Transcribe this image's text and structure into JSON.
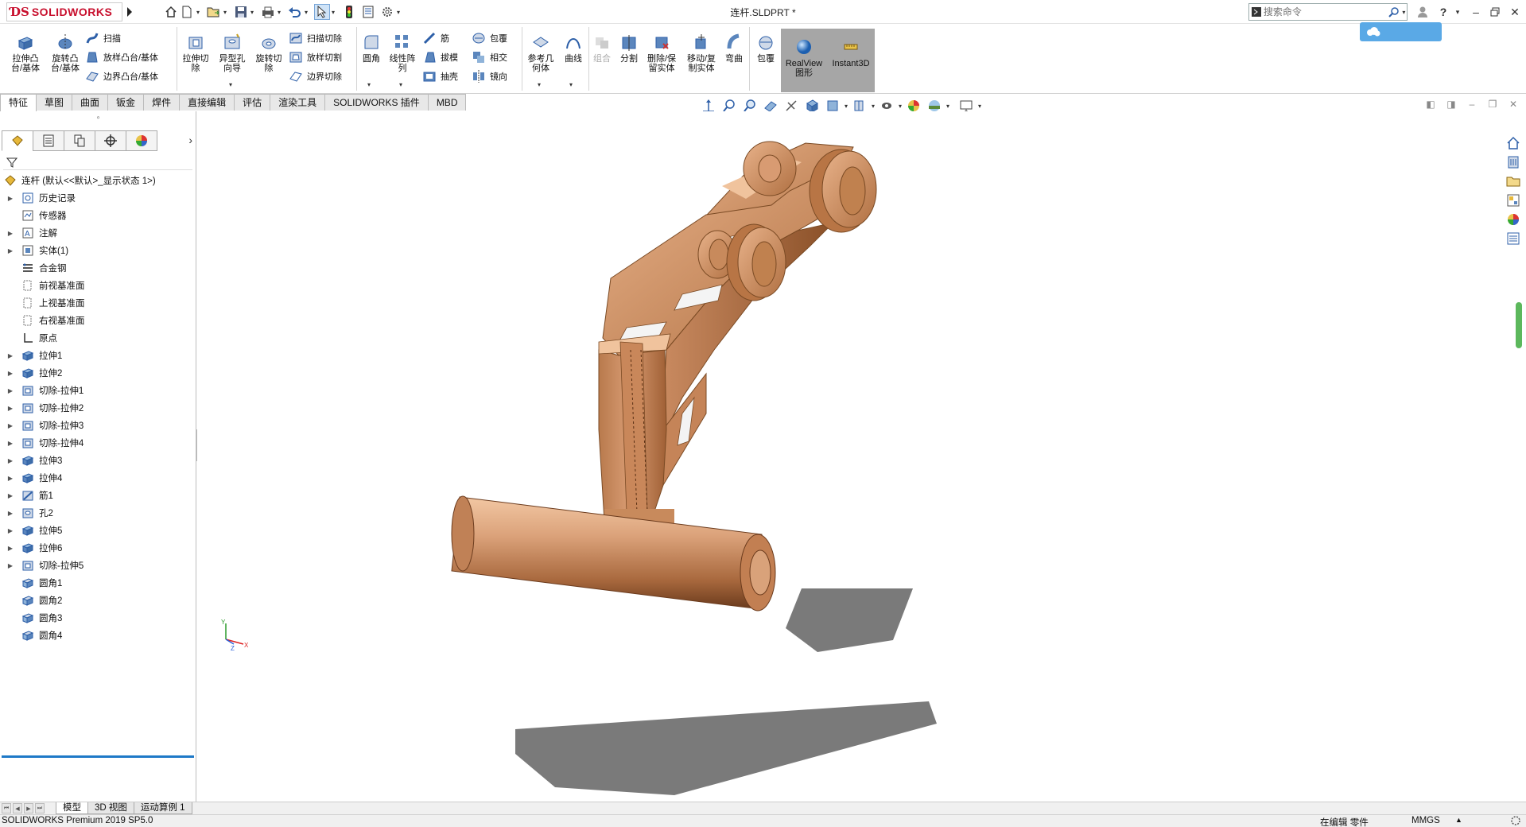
{
  "app": {
    "brand_prefix": "3S",
    "brand_name": "SOLIDWORKS",
    "document_title": "连杆.SLDPRT *"
  },
  "search": {
    "placeholder": "搜索命令"
  },
  "promo_badge": "",
  "command_manager": {
    "extrude_boss": "拉伸凸\n台/基体",
    "revolve_boss": "旋转凸\n台/基体",
    "sweep": "扫描",
    "loft_boss": "放样凸台/基体",
    "boundary_boss": "边界凸台/基体",
    "extrude_cut": "拉伸切\n除",
    "hole_wizard": "异型孔\n向导",
    "revolve_cut": "旋转切\n除",
    "swept_cut": "扫描切除",
    "lofted_cut": "放样切割",
    "boundary_cut": "边界切除",
    "fillet": "圆角",
    "linear_pattern": "线性阵\n列",
    "rib": "筋",
    "draft": "拔模",
    "shell": "抽壳",
    "wrap": "包覆",
    "intersect": "相交",
    "mirror": "镜向",
    "ref_geometry": "参考几\n何体",
    "curves": "曲线",
    "combine": "组合",
    "split": "分割",
    "delete_keep_body": "删除/保\n留实体",
    "move_copy_body": "移动/复\n制实体",
    "flex": "弯曲",
    "wrap2": "包覆",
    "realview": "RealView\n图形",
    "instant3d": "Instant3D"
  },
  "tabs": [
    "特征",
    "草图",
    "曲面",
    "钣金",
    "焊件",
    "直接编辑",
    "评估",
    "渲染工具",
    "SOLIDWORKS 插件",
    "MBD"
  ],
  "feature_tree": {
    "root": "连杆 (默认<<默认>_显示状态 1>)",
    "items": [
      {
        "label": "历史记录",
        "icon": "history-icon",
        "expandable": true
      },
      {
        "label": "传感器",
        "icon": "sensor-icon",
        "expandable": false
      },
      {
        "label": "注解",
        "icon": "annotation-icon",
        "expandable": true
      },
      {
        "label": "实体(1)",
        "icon": "solid-body-icon",
        "expandable": true
      },
      {
        "label": "合金钢",
        "icon": "material-icon",
        "expandable": false
      },
      {
        "label": "前视基准面",
        "icon": "plane-icon",
        "expandable": false
      },
      {
        "label": "上视基准面",
        "icon": "plane-icon",
        "expandable": false
      },
      {
        "label": "右视基准面",
        "icon": "plane-icon",
        "expandable": false
      },
      {
        "label": "原点",
        "icon": "origin-icon",
        "expandable": false
      },
      {
        "label": "拉伸1",
        "icon": "extrude-icon",
        "expandable": true
      },
      {
        "label": "拉伸2",
        "icon": "extrude-icon",
        "expandable": true
      },
      {
        "label": "切除-拉伸1",
        "icon": "cut-extrude-icon",
        "expandable": true
      },
      {
        "label": "切除-拉伸2",
        "icon": "cut-extrude-icon",
        "expandable": true
      },
      {
        "label": "切除-拉伸3",
        "icon": "cut-extrude-icon",
        "expandable": true
      },
      {
        "label": "切除-拉伸4",
        "icon": "cut-extrude-icon",
        "expandable": true
      },
      {
        "label": "拉伸3",
        "icon": "extrude-icon",
        "expandable": true
      },
      {
        "label": "拉伸4",
        "icon": "extrude-icon",
        "expandable": true
      },
      {
        "label": "筋1",
        "icon": "rib-icon",
        "expandable": true
      },
      {
        "label": "孔2",
        "icon": "hole-icon",
        "expandable": true
      },
      {
        "label": "拉伸5",
        "icon": "extrude-icon",
        "expandable": true
      },
      {
        "label": "拉伸6",
        "icon": "extrude-icon",
        "expandable": true
      },
      {
        "label": "切除-拉伸5",
        "icon": "cut-extrude-icon",
        "expandable": true
      },
      {
        "label": "圆角1",
        "icon": "fillet-icon",
        "expandable": false
      },
      {
        "label": "圆角2",
        "icon": "fillet-icon",
        "expandable": false
      },
      {
        "label": "圆角3",
        "icon": "fillet-icon",
        "expandable": false
      },
      {
        "label": "圆角4",
        "icon": "fillet-icon",
        "expandable": false
      }
    ]
  },
  "bottom_tabs": [
    "模型",
    "3D 视图",
    "运动算例 1"
  ],
  "status_bar": {
    "product": "SOLIDWORKS Premium 2019 SP5.0",
    "mode": "在编辑 零件",
    "units": "MMGS",
    "units_arrow": "▲"
  },
  "colors": {
    "brand_red": "#c8102e",
    "part_copper": "#c98a60",
    "selection_blue": "#1e79c7",
    "badge_blue": "#5aa9e6"
  }
}
